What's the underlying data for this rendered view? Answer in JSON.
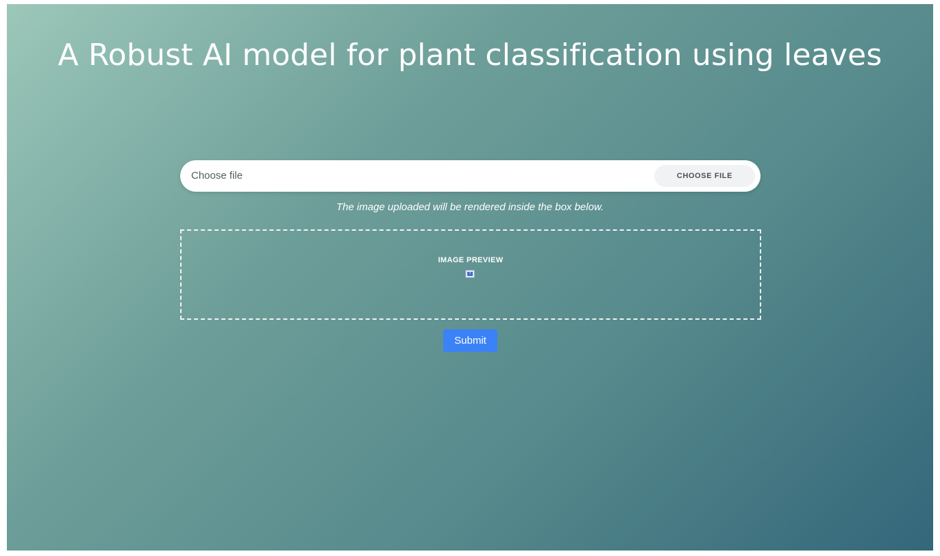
{
  "page": {
    "title": "A Robust AI model for plant classification using leaves"
  },
  "upload": {
    "placeholder": "Choose file",
    "button_label": "CHOOSE FILE",
    "hint": "The image uploaded will be rendered inside the box below."
  },
  "preview": {
    "label": "IMAGE PREVIEW",
    "image_icon": "broken-image-icon"
  },
  "actions": {
    "submit_label": "Submit"
  },
  "colors": {
    "gradient_start": "#9cc7b9",
    "gradient_end": "#34677a",
    "submit_button": "#3b82f6",
    "text": "#ffffff"
  }
}
